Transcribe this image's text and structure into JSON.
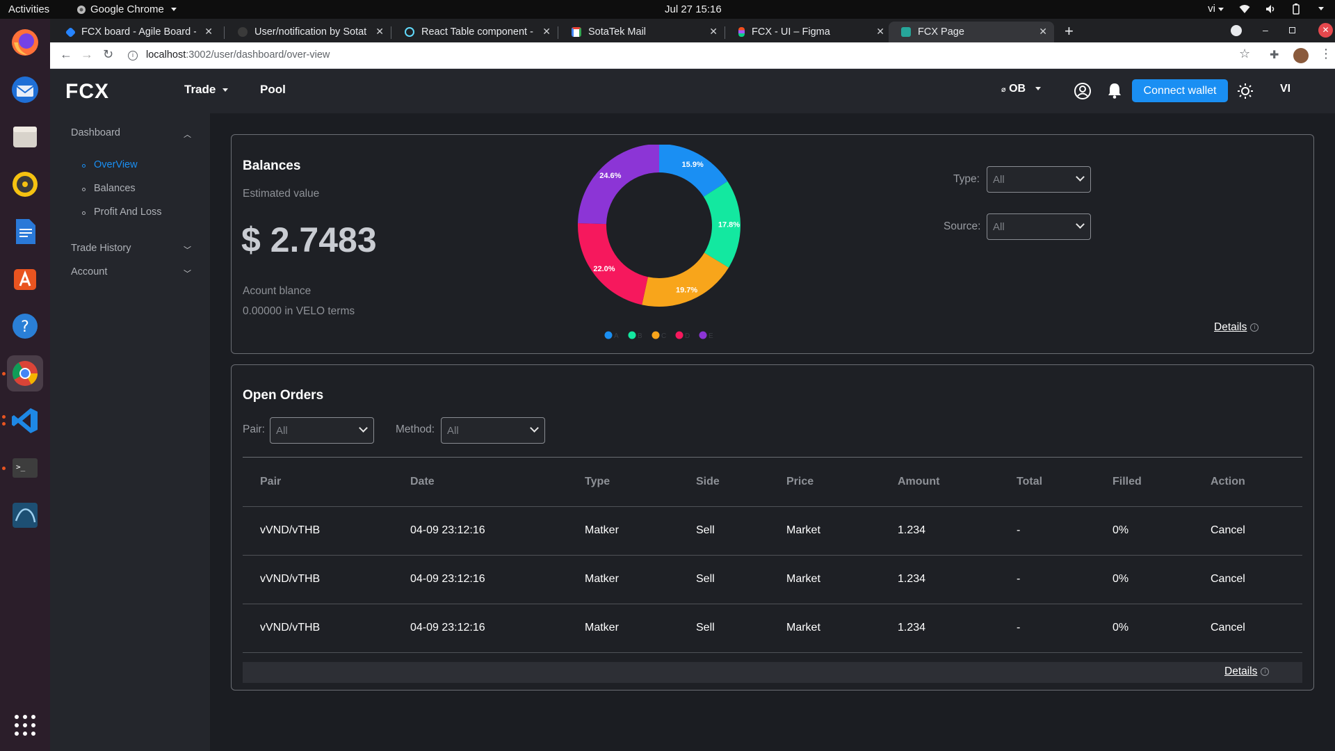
{
  "system_bar": {
    "activities": "Activities",
    "app_name": "Google Chrome",
    "clock": "Jul 27  15:16",
    "lang": "vi"
  },
  "browser": {
    "tabs": [
      {
        "title": "FCX board - Agile Board - S",
        "favicon": "jira-icon",
        "color": "#2684ff"
      },
      {
        "title": "User/notification by Sotat",
        "favicon": "github-icon",
        "color": "#2b2b2b"
      },
      {
        "title": "React Table component - I",
        "favicon": "react-icon",
        "color": "#61dafb"
      },
      {
        "title": "SotaTek Mail",
        "favicon": "gmail-icon",
        "color": "#ea4335"
      },
      {
        "title": "FCX - UI – Figma",
        "favicon": "figma-icon",
        "color": "#f24e1e"
      },
      {
        "title": "FCX Page",
        "favicon": "fcx-icon",
        "color": "#26a69a"
      }
    ],
    "url_host": "localhost",
    "url_path": ":3002/user/dashboard/over-view"
  },
  "header": {
    "logo": "FCX",
    "nav": [
      {
        "label": "Trade",
        "has_dropdown": true
      },
      {
        "label": "Pool",
        "has_dropdown": false
      }
    ],
    "ob_label": "OB",
    "connect_wallet": "Connect wallet",
    "lang": "VI"
  },
  "sidebar": {
    "sections": [
      {
        "label": "Dashboard",
        "expanded": true,
        "items": [
          {
            "label": "OverView",
            "active": true
          },
          {
            "label": "Balances",
            "active": false
          },
          {
            "label": "Profit And Loss",
            "active": false
          }
        ]
      },
      {
        "label": "Trade History",
        "expanded": false
      },
      {
        "label": "Account",
        "expanded": false
      }
    ]
  },
  "balances": {
    "title": "Balances",
    "estimated_label": "Estimated value",
    "value": "$ 2.7483",
    "account_label": "Acount blance",
    "velo_terms": "0.00000 in VELO terms",
    "type_label": "Type:",
    "type_value": "All",
    "source_label": "Source:",
    "source_value": "All",
    "details": "Details"
  },
  "chart_data": {
    "type": "pie",
    "variant": "donut",
    "categories": [
      "A",
      "B",
      "C",
      "D",
      "E"
    ],
    "values": [
      15.9,
      17.8,
      19.7,
      22.0,
      24.6
    ],
    "labels": [
      "15.9%",
      "17.8%",
      "19.7%",
      "22.0%",
      "24.6%"
    ],
    "colors": [
      "#1a8ff3",
      "#13e8a0",
      "#f8a51b",
      "#f6185d",
      "#8c35d6"
    ],
    "legend": "bottom"
  },
  "open_orders": {
    "title": "Open Orders",
    "pair_label": "Pair:",
    "pair_value": "All",
    "method_label": "Method:",
    "method_value": "All",
    "columns": [
      "Pair",
      "Date",
      "Type",
      "Side",
      "Price",
      "Amount",
      "Total",
      "Filled",
      "Action"
    ],
    "rows": [
      [
        "vVND/vTHB",
        "04-09 23:12:16",
        "Matker",
        "Sell",
        "Market",
        "1.234",
        "-",
        "0%",
        "Cancel"
      ],
      [
        "vVND/vTHB",
        "04-09 23:12:16",
        "Matker",
        "Sell",
        "Market",
        "1.234",
        "-",
        "0%",
        "Cancel"
      ],
      [
        "vVND/vTHB",
        "04-09 23:12:16",
        "Matker",
        "Sell",
        "Market",
        "1.234",
        "-",
        "0%",
        "Cancel"
      ]
    ],
    "details": "Details"
  }
}
